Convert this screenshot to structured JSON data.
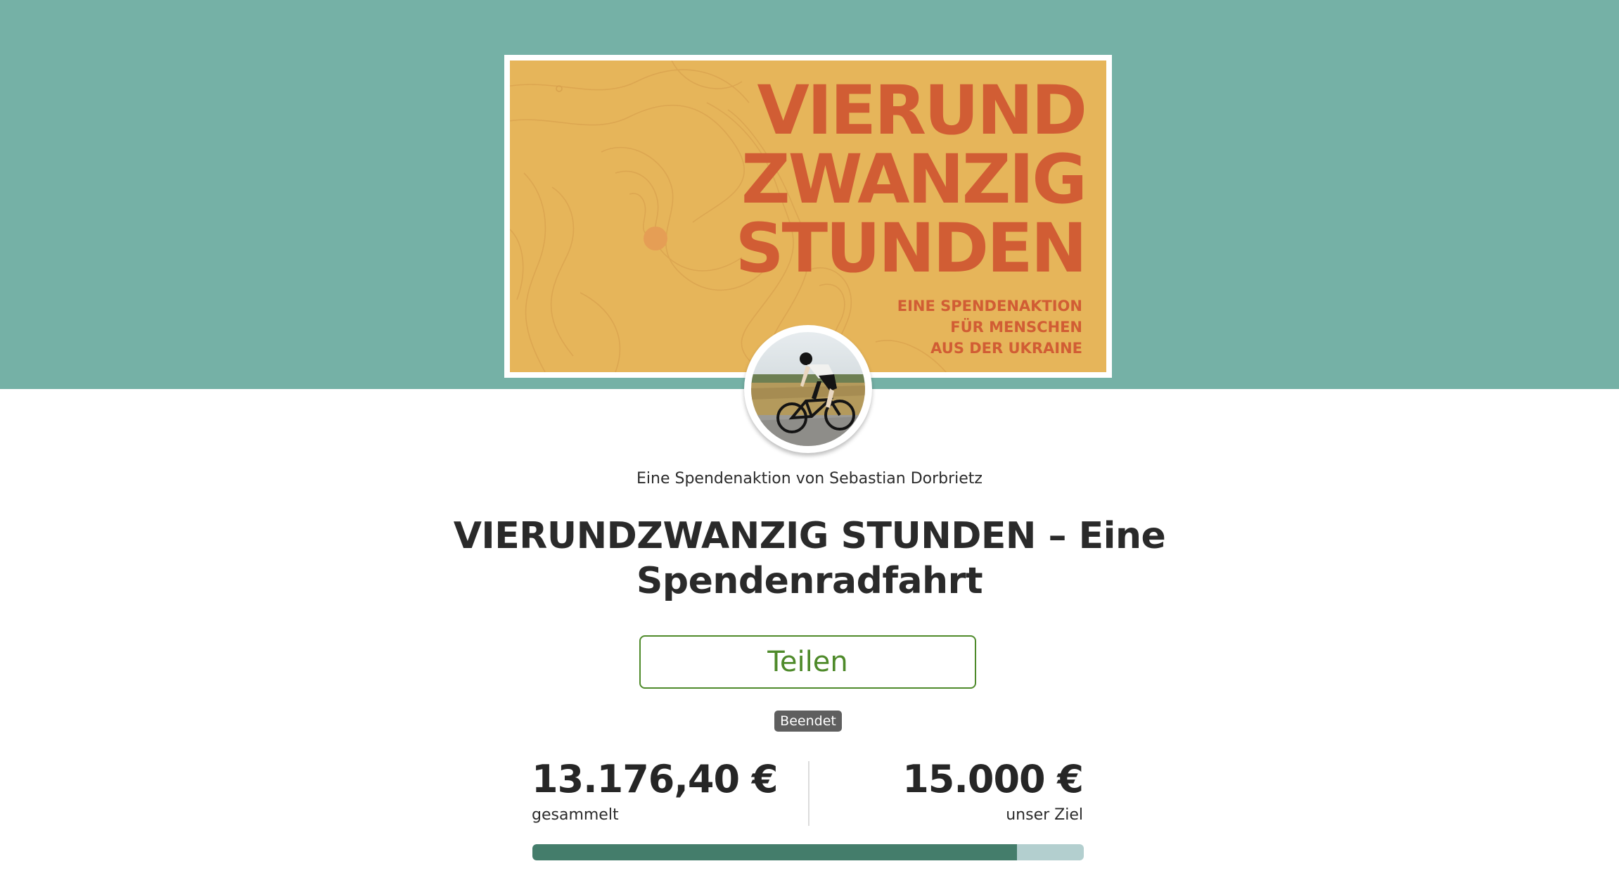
{
  "banner": {
    "title_lines": [
      "VIERUND",
      "ZWANZIG",
      "STUNDEN"
    ],
    "subtitle_lines": [
      "EINE SPENDENAKTION",
      "FÜR MENSCHEN",
      "AUS DER UKRAINE"
    ],
    "icon": "topographic-map-illustration"
  },
  "avatar": {
    "icon": "cyclist-photo"
  },
  "organizer_text": "Eine Spendenaktion von Sebastian Dorbrietz",
  "title": "VIERUNDZWANZIG STUNDEN – Eine Spendenradfahrt",
  "share_label": "Teilen",
  "status_badge": "Beendet",
  "stats": {
    "collected_value": "13.176,40 €",
    "collected_label": "gesammelt",
    "goal_value": "15.000 €",
    "goal_label": "unser Ziel"
  },
  "progress": {
    "fraction": 0.8784
  },
  "colors": {
    "header_band": "#75b1a6",
    "banner_bg": "#e6b55a",
    "banner_text": "#d15d34",
    "accent_green": "#4e8a2a",
    "progress_fill": "#447d6b",
    "progress_track": "#b3cfcf",
    "badge_bg": "#5f5f5f"
  }
}
